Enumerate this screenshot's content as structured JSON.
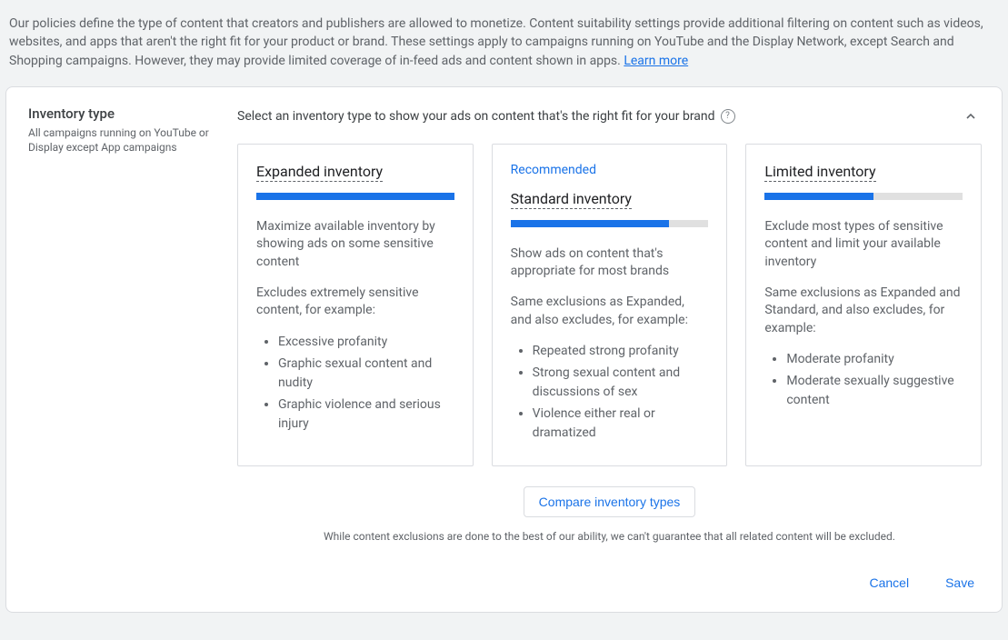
{
  "intro": {
    "text": "Our policies define the type of content that creators and publishers are allowed to monetize. Content suitability settings provide additional filtering on content such as videos, websites, and apps that aren't the right fit for your product or brand. These settings apply to campaigns running on YouTube and the Display Network, except Search and Shopping campaigns. However, they may provide limited coverage of in-feed ads and content shown in apps. ",
    "learn_more": "Learn more"
  },
  "section": {
    "title": "Inventory type",
    "subtitle": "All campaigns running on YouTube or Display except App campaigns",
    "instruction": "Select an inventory type to show your ads on content that's the right fit for your brand"
  },
  "cards": [
    {
      "recommended": "",
      "title": "Expanded inventory",
      "fill_percent": 100,
      "desc1": "Maximize available inventory by showing ads on some sensitive content",
      "desc2": "Excludes extremely sensitive content, for example:",
      "bullets": [
        "Excessive profanity",
        "Graphic sexual content and nudity",
        "Graphic violence and serious injury"
      ]
    },
    {
      "recommended": "Recommended",
      "title": "Standard inventory",
      "fill_percent": 80,
      "desc1": "Show ads on content that's appropriate for most brands",
      "desc2": "Same exclusions as Expanded, and also excludes, for example:",
      "bullets": [
        "Repeated strong profanity",
        "Strong sexual content and discussions of sex",
        "Violence either real or dramatized"
      ]
    },
    {
      "recommended": "",
      "title": "Limited inventory",
      "fill_percent": 55,
      "desc1": "Exclude most types of sensitive content and limit your available inventory",
      "desc2": "Same exclusions as Expanded and Standard, and also excludes, for example:",
      "bullets": [
        "Moderate profanity",
        "Moderate sexually suggestive content"
      ]
    }
  ],
  "compare_label": "Compare inventory types",
  "disclaimer": "While content exclusions are done to the best of our ability, we can't guarantee that all related content will be excluded.",
  "footer": {
    "cancel": "Cancel",
    "save": "Save"
  }
}
